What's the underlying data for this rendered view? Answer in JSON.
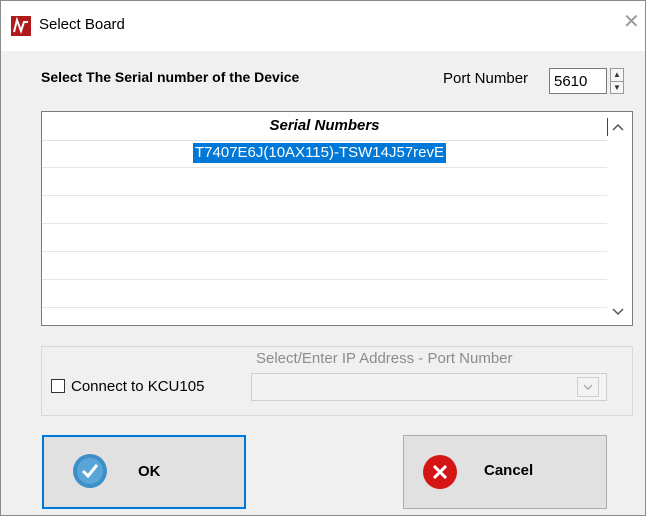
{
  "window": {
    "title": "Select Board",
    "close_glyph": "✕"
  },
  "header": {
    "serial_prompt": "Select The Serial number of the Device",
    "port_label": "Port Number",
    "port_value": "5610"
  },
  "serial_list": {
    "column_header": "Serial Numbers",
    "rows": [
      "T7407E6J(10AX115)-TSW14J57revE",
      "",
      "",
      "",
      "",
      "",
      ""
    ],
    "selected_index": 0
  },
  "ip_group": {
    "label": "Select/Enter IP Address - Port Number",
    "checkbox_label": "Connect to KCU105",
    "checkbox_checked": false,
    "ip_value": ""
  },
  "buttons": {
    "ok_label": "OK",
    "cancel_label": "Cancel"
  },
  "icons": {
    "app": "app-logo-icon",
    "ok": "checkmark-icon",
    "cancel": "x-circle-icon"
  },
  "colors": {
    "selection": "#0078d7",
    "ok_icon": "#3d8fc7",
    "cancel_icon": "#e01818"
  }
}
